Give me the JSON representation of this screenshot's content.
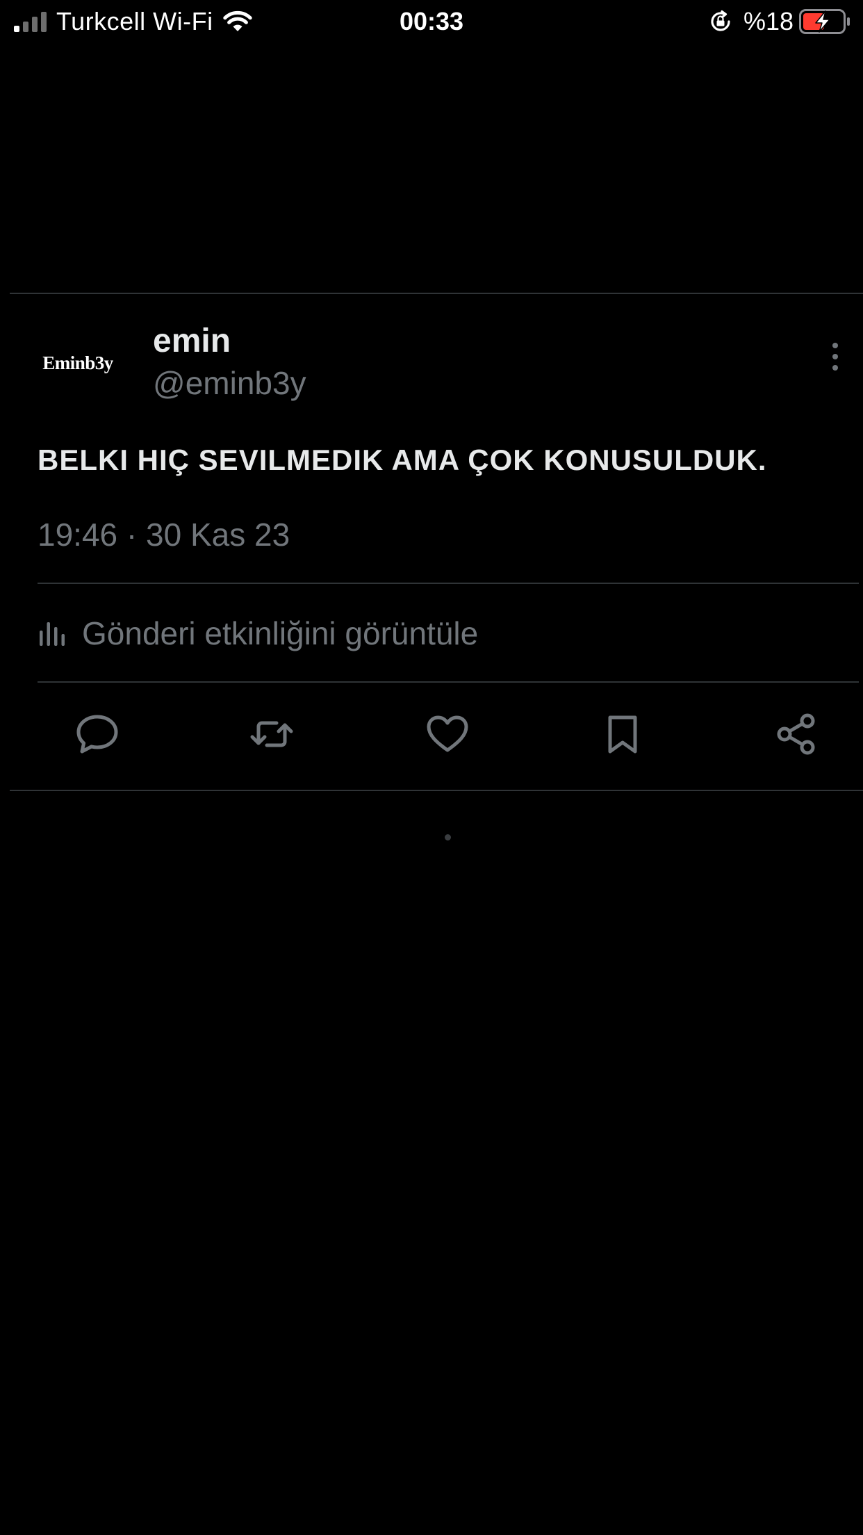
{
  "status_bar": {
    "carrier": "Turkcell Wi-Fi",
    "time": "00:33",
    "battery_percent": "%18",
    "signal_bars_active": 1,
    "signal_bars_total": 4,
    "battery_level": 0.18,
    "icons": [
      "signal-icon",
      "wifi-icon",
      "orientation-lock-icon",
      "battery-charging-icon"
    ]
  },
  "post": {
    "avatar_text": "Eminb3y",
    "display_name": "emin",
    "handle": "@eminb3y",
    "text": "BELKI HIÇ SEVILMEDIK AMA ÇOK KONUSULDUK.",
    "timestamp": "19:46 · 30 Kas 23",
    "activity_label": "Gönderi etkinliğini görüntüle",
    "actions": [
      "reply-icon",
      "repost-icon",
      "like-icon",
      "bookmark-icon",
      "share-icon"
    ]
  },
  "colors": {
    "background": "#000000",
    "primary_text": "#e7e9ea",
    "secondary_text": "#71767b",
    "divider": "#2f3336",
    "battery_low": "#ff3b30"
  }
}
